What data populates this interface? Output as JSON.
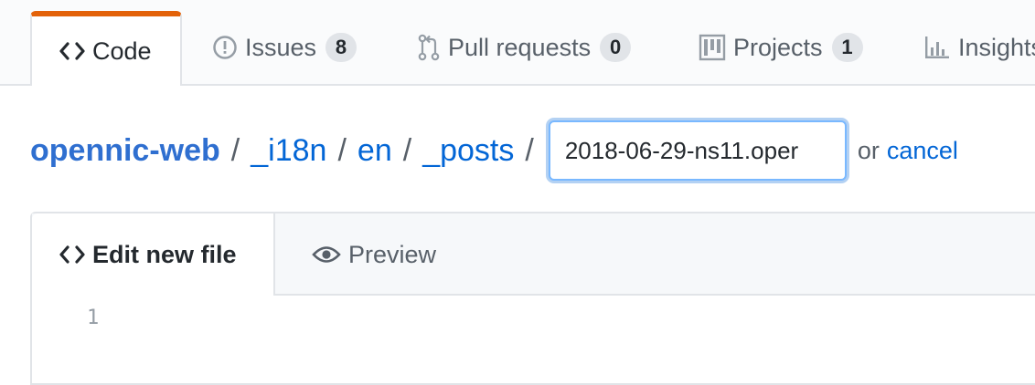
{
  "repo_nav": {
    "tabs": [
      {
        "label": "Code",
        "icon": "code-icon",
        "selected": true
      },
      {
        "label": "Issues",
        "icon": "issue-opened-icon",
        "count": "8"
      },
      {
        "label": "Pull requests",
        "icon": "git-pull-request-icon",
        "count": "0"
      },
      {
        "label": "Projects",
        "icon": "project-icon",
        "count": "1"
      },
      {
        "label": "Insights",
        "icon": "graph-icon"
      }
    ]
  },
  "breadcrumb": {
    "repo": "opennic-web",
    "path": [
      "_i18n",
      "en",
      "_posts"
    ],
    "separator": "/",
    "filename_value": "2018-06-29-ns11.oper",
    "or_text": "or",
    "cancel_label": "cancel"
  },
  "editor": {
    "tabs": [
      {
        "label": "Edit new file",
        "icon": "code-icon",
        "active": true
      },
      {
        "label": "Preview",
        "icon": "eye-icon"
      }
    ],
    "line_numbers": [
      "1"
    ]
  },
  "colors": {
    "selected_tab_accent": "#e36209",
    "link": "#0366d6",
    "counter_bg": "#e1e4e8",
    "focus_border": "#79b8ff"
  }
}
